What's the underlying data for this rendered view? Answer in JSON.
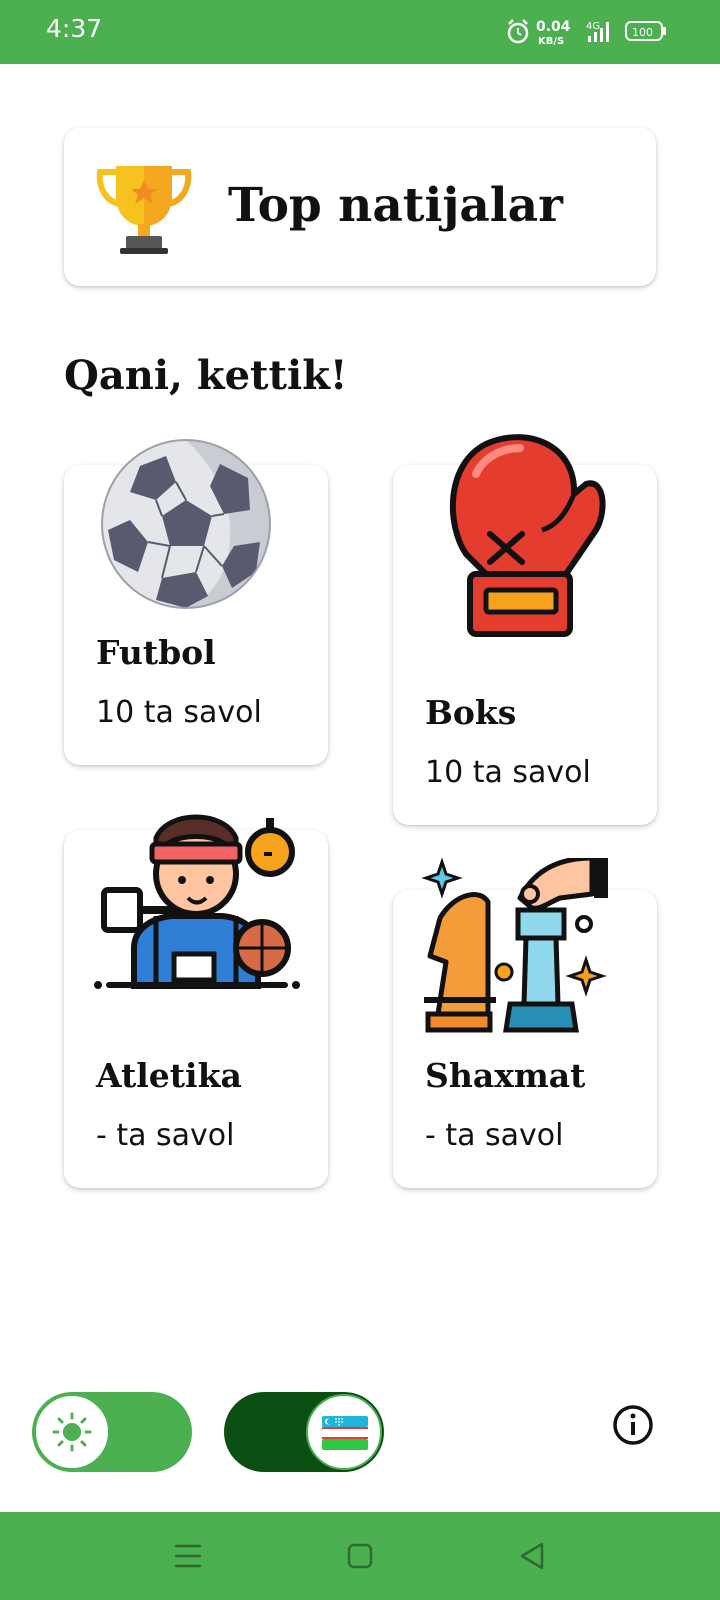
{
  "status_bar": {
    "time": "4:37",
    "network_speed": "0.04",
    "network_unit": "KB/S",
    "network_type": "4G",
    "battery": "100"
  },
  "top_results": {
    "label": "Top natijalar",
    "icon": "trophy-icon"
  },
  "section_title": "Qani, kettik!",
  "categories": [
    {
      "name": "Futbol",
      "count": "10 ta savol",
      "icon": "soccer-ball-icon"
    },
    {
      "name": "Boks",
      "count": "10 ta savol",
      "icon": "boxing-glove-icon"
    },
    {
      "name": "Atletika",
      "count": "- ta savol",
      "icon": "athlete-icon"
    },
    {
      "name": "Shaxmat",
      "count": "- ta savol",
      "icon": "chess-icon"
    }
  ],
  "controls": {
    "theme_toggle_icon": "sun-icon",
    "language_toggle_icon": "uzbekistan-flag-icon",
    "info_icon": "info-icon"
  },
  "nav_bar": {
    "menu_icon": "menu-icon",
    "home_icon": "home-square-icon",
    "back_icon": "back-triangle-icon"
  },
  "colors": {
    "primary": "#4caf50",
    "dark_green": "#0b4f12",
    "text": "#111111"
  }
}
